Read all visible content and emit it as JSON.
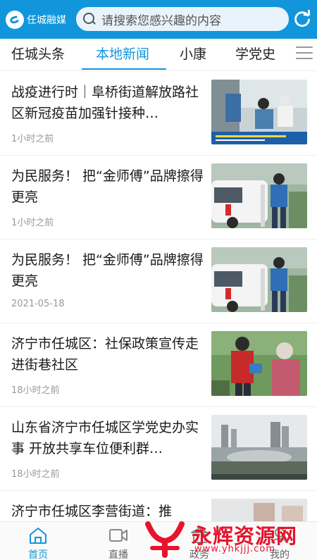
{
  "header": {
    "logo_text": "任城融媒",
    "search_placeholder": "请搜索您感兴趣的内容",
    "brand_color": "#1296db"
  },
  "tabs": [
    {
      "label": "任城头条",
      "active": false
    },
    {
      "label": "本地新闻",
      "active": true
    },
    {
      "label": "小康",
      "active": false
    },
    {
      "label": "学党史",
      "active": false
    }
  ],
  "feed": [
    {
      "title": "战疫进行时｜阜桥街道解放路社区新冠疫苗加强针接种…",
      "time": "1小时之前",
      "image": "vaccination-scene"
    },
    {
      "title": "为民服务！ 把“金师傅”品牌擦得更亮",
      "time": "1小时之前",
      "image": "service-car"
    },
    {
      "title": "为民服务！ 把“金师傅”品牌擦得更亮",
      "time": "2021-05-18",
      "image": "service-car"
    },
    {
      "title": "济宁市任城区：社保政策宣传走进街巷社区",
      "time": "18小时之前",
      "image": "policy-outreach"
    },
    {
      "title": "山东省济宁市任城区学党史办实事 开放共享车位便利群…",
      "time": "18小时之前",
      "image": "city-skyline"
    },
    {
      "title": "济宁市任城区李营街道：推",
      "time": "",
      "image": "street-scene"
    }
  ],
  "bottom_nav": [
    {
      "label": "首页",
      "icon": "home-icon",
      "active": true
    },
    {
      "label": "直播",
      "icon": "video-icon",
      "active": false
    },
    {
      "label": "政务",
      "icon": "government-icon",
      "active": false
    },
    {
      "label": "我的",
      "icon": "user-icon",
      "active": false
    }
  ],
  "watermark": {
    "title": "永辉资源网",
    "url": "www.yhkjjj.com",
    "color": "#e8132c"
  }
}
